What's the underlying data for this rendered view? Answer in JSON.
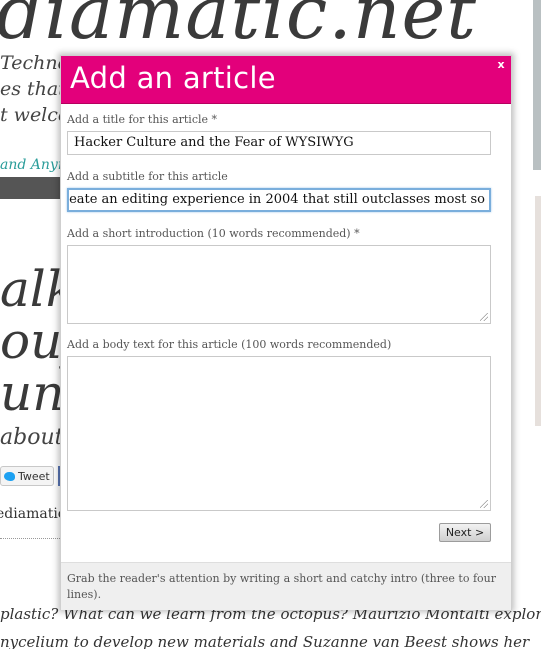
{
  "background": {
    "site_title": "diamatic.net",
    "tagline": [
      "Techno",
      "es that",
      "t welco"
    ],
    "author_line": "and Anym",
    "headline_lines": [
      "alk:",
      "oufi",
      "un"
    ],
    "about": "about",
    "tweet_label": "Tweet",
    "diamatic_link": "ediamatic",
    "paragraph": [
      "plastic? What can we learn from the octopus? Maurizio Montalti explores",
      "nycelium to develop new materials and Suzanne van Beest shows her"
    ]
  },
  "dialog": {
    "title": "Add an article",
    "close_label": "x",
    "title_field": {
      "label": "Add a title for this article *",
      "value": "Hacker Culture and the Fear of WYSIWYG"
    },
    "subtitle_field": {
      "label": "Add a subtitle for this article",
      "value": "eate an editing experience in 2004 that still outclasses most so"
    },
    "intro_field": {
      "label": "Add a short introduction (10 words recommended) *",
      "value": ""
    },
    "body_field": {
      "label": "Add a body text for this article (100 words recommended)",
      "value": ""
    },
    "next_label": "Next >",
    "hint": "Grab the reader's attention by writing a short and catchy intro (three to four lines)."
  },
  "colors": {
    "header": "#e3007b",
    "focus_border": "#7aaedc"
  }
}
